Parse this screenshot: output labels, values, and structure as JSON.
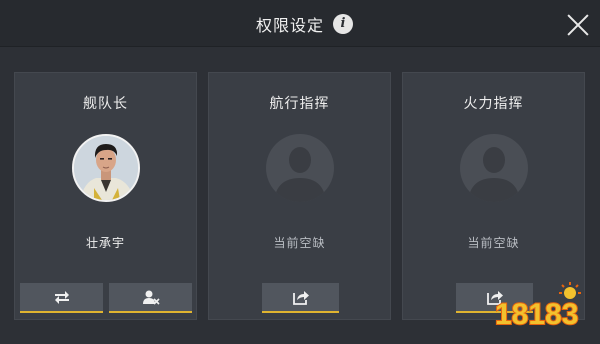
{
  "header": {
    "title": "权限设定",
    "info_icon": "info-icon",
    "close_icon": "close-icon"
  },
  "panels": [
    {
      "role": "舰队长",
      "name": "壮承宇",
      "avatar": "player-portrait",
      "buttons": [
        {
          "icon": "swap-icon"
        },
        {
          "icon": "remove-user-icon"
        }
      ]
    },
    {
      "role": "航行指挥",
      "name": "当前空缺",
      "avatar": "empty-silhouette-icon",
      "buttons": [
        {
          "icon": "assign-icon"
        }
      ]
    },
    {
      "role": "火力指挥",
      "name": "当前空缺",
      "avatar": "empty-silhouette-icon",
      "buttons": [
        {
          "icon": "assign-icon"
        }
      ]
    }
  ],
  "watermark": {
    "text": "18183",
    "colors": {
      "primary": "#f2c12e",
      "outline": "#e8640c"
    }
  },
  "colors": {
    "background": "#2d3036",
    "panel": "#3a3e45",
    "button": "#51565e",
    "accent": "#e0b430"
  }
}
